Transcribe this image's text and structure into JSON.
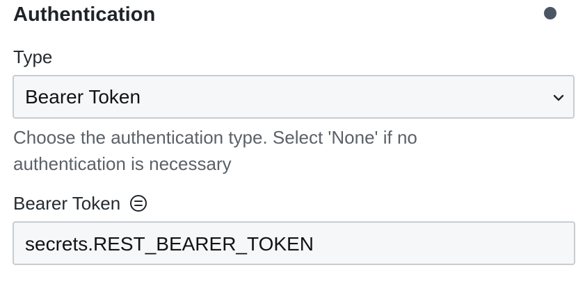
{
  "section": {
    "title": "Authentication"
  },
  "type_field": {
    "label": "Type",
    "selected_value": "Bearer Token",
    "helper_text": "Choose the authentication type. Select 'None' if no authentication is necessary"
  },
  "bearer_token_field": {
    "label": "Bearer Token",
    "value": "secrets.REST_BEARER_TOKEN",
    "icon": "secret-reference-icon"
  },
  "colors": {
    "status_dot": "#4b5563",
    "input_border": "#c8ccd1",
    "input_background": "#f6f7f8",
    "helper_text": "#5b6168"
  }
}
